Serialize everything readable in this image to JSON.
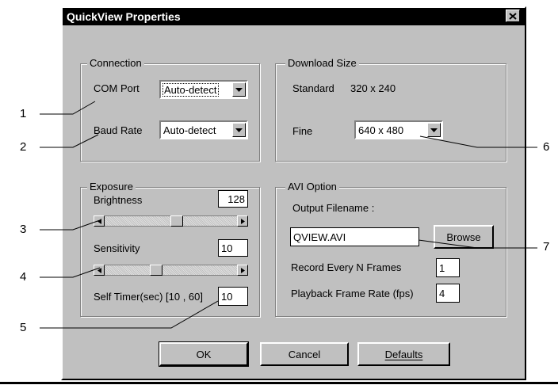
{
  "window": {
    "title": "QuickView Properties",
    "close_label": "✕"
  },
  "connection": {
    "legend": "Connection",
    "com_port_label": "COM Port",
    "com_port_value": "Auto-detect",
    "baud_rate_label": "Baud Rate",
    "baud_rate_value": "Auto-detect"
  },
  "download": {
    "legend": "Download Size",
    "standard_label": "Standard",
    "standard_value": "320 x 240",
    "fine_label": "Fine",
    "fine_value": "640 x 480"
  },
  "exposure": {
    "legend": "Exposure",
    "brightness_label": "Brightness",
    "brightness_value": "128",
    "brightness_level": 0.55,
    "sensitivity_label": "Sensitivity",
    "sensitivity_value": "10",
    "sensitivity_level": 0.38,
    "self_timer_label": "Self Timer(sec) [10 , 60]",
    "self_timer_value": "10"
  },
  "avi": {
    "legend": "AVI Option",
    "output_label": "Output Filename :",
    "output_value": "QVIEW.AVI",
    "browse_label": "Browse",
    "record_label": "Record Every N Frames",
    "record_value": "1",
    "playback_label": "Playback Frame Rate (fps)",
    "playback_value": "4"
  },
  "buttons": {
    "ok": "OK",
    "cancel": "Cancel",
    "defaults": "Defaults"
  },
  "callouts": [
    "1",
    "2",
    "3",
    "4",
    "5",
    "6",
    "7"
  ]
}
